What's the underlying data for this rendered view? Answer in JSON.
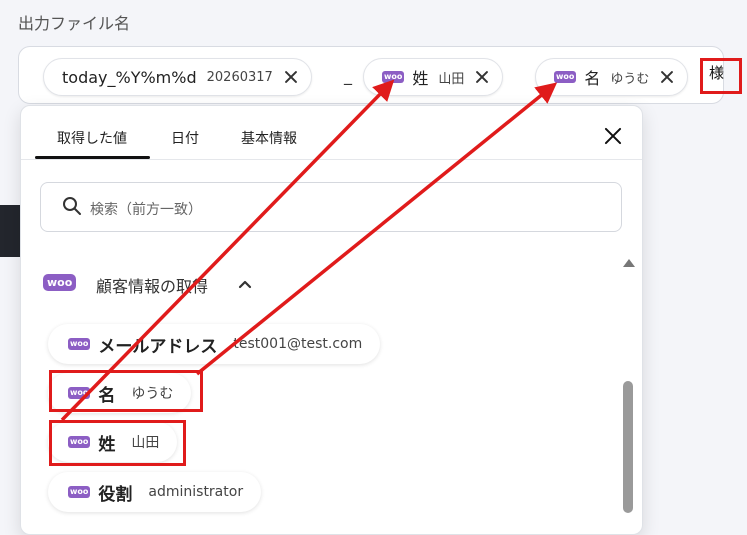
{
  "field": {
    "label": "出力ファイル名",
    "chips": [
      {
        "title": "today_%Y%m%d",
        "sample": "20260317",
        "icon": "close-icon"
      },
      {
        "title": "姓",
        "sample": "山田",
        "icon": "close-icon",
        "badge": "woo"
      },
      {
        "title": "名",
        "sample": "ゆうむ",
        "icon": "close-icon",
        "badge": "woo"
      }
    ],
    "separator": "_",
    "suffix": "様"
  },
  "panel": {
    "tabs": [
      "取得した値",
      "日付",
      "基本情報"
    ],
    "active_tab": "取得した値",
    "search_placeholder": "検索（前方一致）",
    "section": {
      "badge": "woo",
      "title": "顧客情報の取得"
    },
    "items": [
      {
        "title": "メールアドレス",
        "sample": "test001@test.com"
      },
      {
        "title": "名",
        "sample": "ゆうむ"
      },
      {
        "title": "姓",
        "sample": "山田"
      },
      {
        "title": "役割",
        "sample": "administrator"
      }
    ]
  },
  "colors": {
    "woo_purple": "#8c5ec4",
    "annotation_red": "#e01b1b"
  }
}
